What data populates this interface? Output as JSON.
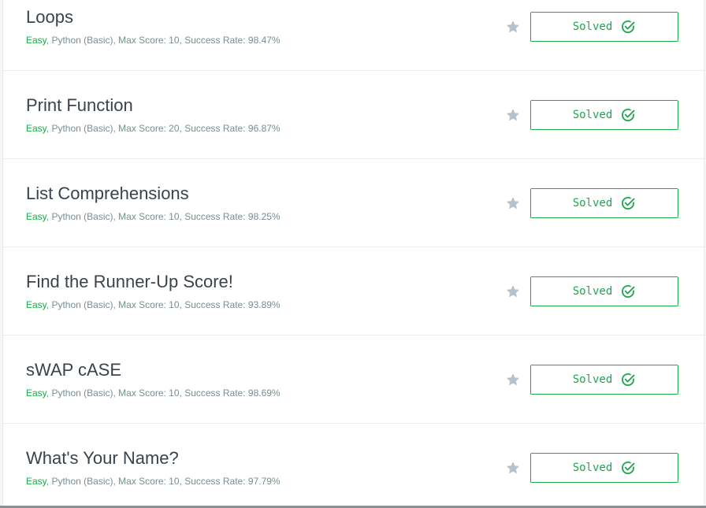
{
  "challenges": [
    {
      "title": "Loops",
      "difficulty": "Easy",
      "details": ", Python (Basic), Max Score: 10, Success Rate: 98.47%",
      "status": "Solved"
    },
    {
      "title": "Print Function",
      "difficulty": "Easy",
      "details": ", Python (Basic), Max Score: 20, Success Rate: 96.87%",
      "status": "Solved"
    },
    {
      "title": "List Comprehensions",
      "difficulty": "Easy",
      "details": ", Python (Basic), Max Score: 10, Success Rate: 98.25%",
      "status": "Solved"
    },
    {
      "title": "Find the Runner-Up Score!",
      "difficulty": "Easy",
      "details": ", Python (Basic), Max Score: 10, Success Rate: 93.89%",
      "status": "Solved"
    },
    {
      "title": "sWAP cASE",
      "difficulty": "Easy",
      "details": ", Python (Basic), Max Score: 10, Success Rate: 98.69%",
      "status": "Solved"
    },
    {
      "title": "What's Your Name?",
      "difficulty": "Easy",
      "details": ", Python (Basic), Max Score: 10, Success Rate: 97.79%",
      "status": "Solved"
    }
  ],
  "icons": {
    "star": "star-icon",
    "solved": "check-circle-icon"
  },
  "colors": {
    "accent_green": "#1ba94c",
    "title_text": "#39424e",
    "meta_text": "#738f93",
    "star_gray": "#b7c3cc"
  }
}
